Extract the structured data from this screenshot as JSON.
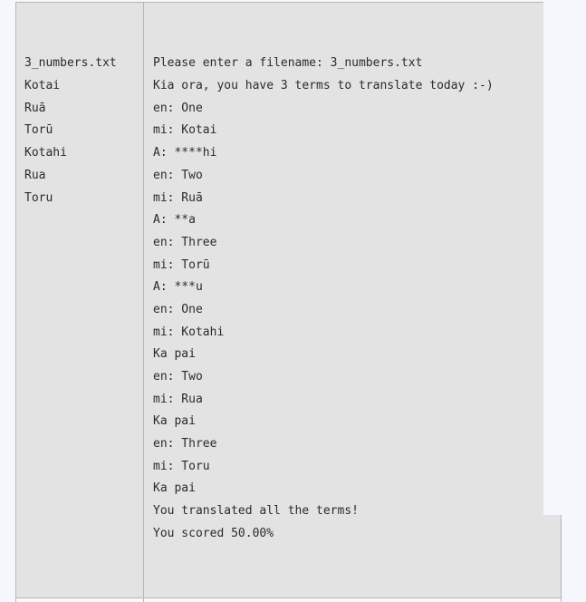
{
  "panel": {
    "columns": [
      {
        "name": "expected-output",
        "header": ""
      },
      {
        "name": "actual-output",
        "header": ""
      }
    ],
    "colors": {
      "page_background": "#f5f7fc",
      "cell_background": "#e3e3e3",
      "cell_border": "#b6b6b6",
      "text": "#2b2b2b"
    }
  },
  "expected_output": {
    "lines": [
      "3_numbers.txt",
      "Kotai",
      "Ruā",
      "Torū",
      "Kotahi",
      "Rua",
      "Toru"
    ]
  },
  "actual_output": {
    "lines": [
      "Please enter a filename: 3_numbers.txt",
      "Kia ora, you have 3 terms to translate today :-)",
      "en: One",
      "mi: Kotai",
      "A: ****hi",
      "en: Two",
      "mi: Ruā",
      "A: **a",
      "en: Three",
      "mi: Torū",
      "A: ***u",
      "en: One",
      "mi: Kotahi",
      "Ka pai",
      "en: Two",
      "mi: Rua",
      "Ka pai",
      "en: Three",
      "mi: Toru",
      "Ka pai",
      "You translated all the terms!",
      "You scored 50.00%"
    ]
  }
}
